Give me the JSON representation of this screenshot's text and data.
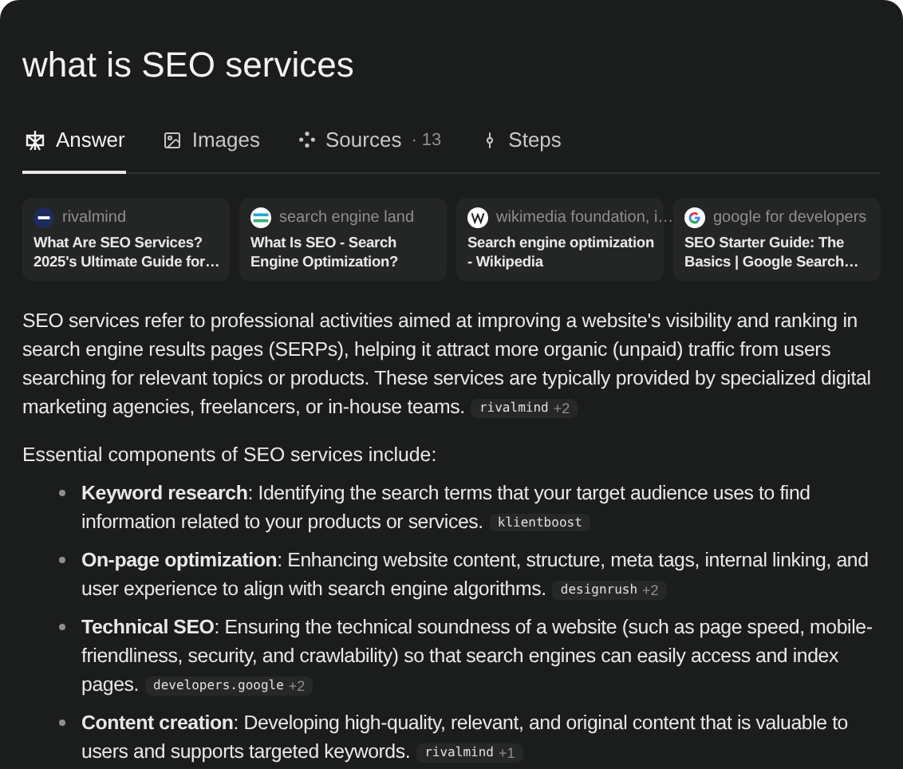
{
  "query": "what is SEO services",
  "tabs": [
    {
      "label": "Answer",
      "kind": "answer",
      "selected": true
    },
    {
      "label": "Images",
      "kind": "images",
      "selected": false
    },
    {
      "label": "Sources",
      "kind": "sources",
      "count": "· 13",
      "selected": false
    },
    {
      "label": "Steps",
      "kind": "steps",
      "selected": false
    }
  ],
  "sources": [
    {
      "site": "rivalmind",
      "kind": "rm",
      "title": "What Are SEO Services? 2025's Ultimate Guide for…"
    },
    {
      "site": "search engine land",
      "kind": "sel",
      "title": "What Is SEO - Search Engine Optimization?"
    },
    {
      "site": "wikimedia foundation, i…",
      "kind": "wiki",
      "title": "Search engine optimization - Wikipedia"
    },
    {
      "site": "google for developers",
      "kind": "google",
      "title": "SEO Starter Guide: The Basics | Google Search…"
    }
  ],
  "intro": {
    "text": "SEO services refer to professional activities aimed at improving a website's visibility and ranking in search engine results pages (SERPs), helping it attract more organic (unpaid) traffic from users searching for relevant topics or products. These services are typically provided by specialized digital marketing agencies, freelancers, or in-house teams.",
    "citation": {
      "source": "rivalmind",
      "more": "+2"
    }
  },
  "list_heading": "Essential components of SEO services include:",
  "components": [
    {
      "text": "**Keyword research**: Identifying the search terms that your target audience uses to find information related to your products or services.",
      "citation": {
        "source": "klientboost"
      }
    },
    {
      "text": "**On-page optimization**: Enhancing website content, structure, meta tags, internal linking, and user experience to align with search engine algorithms.",
      "citation": {
        "source": "designrush",
        "more": "+2"
      }
    },
    {
      "text": "**Technical SEO**: Ensuring the technical soundness of a website (such as page speed, mobile-friendliness, security, and crawlability) so that search engines can easily access and index pages.",
      "citation": {
        "source": "developers.google",
        "more": "+2"
      }
    },
    {
      "text": "**Content creation**: Developing high-quality, relevant, and original content that is valuable to users and supports targeted keywords.",
      "citation": {
        "source": "rivalmind",
        "more": "+1"
      }
    }
  ]
}
